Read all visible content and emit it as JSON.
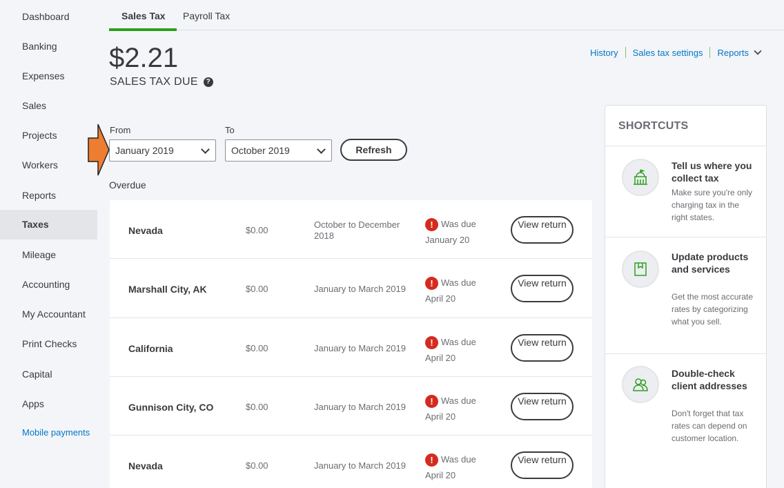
{
  "sidebar": {
    "items": [
      {
        "label": "Dashboard"
      },
      {
        "label": "Banking"
      },
      {
        "label": "Expenses"
      },
      {
        "label": "Sales"
      },
      {
        "label": "Projects"
      },
      {
        "label": "Workers"
      },
      {
        "label": "Reports"
      },
      {
        "label": "Taxes",
        "active": true
      },
      {
        "label": "Mileage"
      },
      {
        "label": "Accounting"
      },
      {
        "label": "My Accountant"
      },
      {
        "label": "Print Checks"
      },
      {
        "label": "Capital"
      },
      {
        "label": "Apps"
      }
    ],
    "mobile_payments": "Mobile payments"
  },
  "tabs": [
    {
      "label": "Sales Tax",
      "active": true
    },
    {
      "label": "Payroll Tax"
    }
  ],
  "header": {
    "amount": "$2.21",
    "amount_label": "SALES TAX DUE",
    "links": {
      "history": "History",
      "settings": "Sales tax settings",
      "reports": "Reports"
    }
  },
  "filters": {
    "from_label": "From",
    "from_value": "January 2019",
    "to_label": "To",
    "to_value": "October 2019",
    "refresh": "Refresh"
  },
  "section_label": "Overdue",
  "rows": [
    {
      "name": "Nevada",
      "amount": "$0.00",
      "period": "October to December 2018",
      "due_label": "Was due",
      "due_date": "January 20",
      "action": "View return"
    },
    {
      "name": "Marshall City, AK",
      "amount": "$0.00",
      "period": "January to March 2019",
      "due_label": "Was due",
      "due_date": "April 20",
      "action": "View return"
    },
    {
      "name": "California",
      "amount": "$0.00",
      "period": "January to March 2019",
      "due_label": "Was due",
      "due_date": "April 20",
      "action": "View return"
    },
    {
      "name": "Gunnison City, CO",
      "amount": "$0.00",
      "period": "January to March 2019",
      "due_label": "Was due",
      "due_date": "April 20",
      "action": "View return"
    },
    {
      "name": "Nevada",
      "amount": "$0.00",
      "period": "January to March 2019",
      "due_label": "Was due",
      "due_date": "April 20",
      "action": "View return"
    }
  ],
  "shortcuts": {
    "title": "SHORTCUTS",
    "items": [
      {
        "icon": "building-icon",
        "heading": "Tell us where you collect tax",
        "desc": "Make sure you're only charging tax in the right states."
      },
      {
        "icon": "box-icon",
        "heading": "Update products and services",
        "desc": "Get the most accurate rates by categorizing what you sell."
      },
      {
        "icon": "people-icon",
        "heading": "Double-check client addresses",
        "desc": "Don't forget that tax rates can depend on customer location."
      }
    ]
  },
  "colors": {
    "accent_green": "#2ca01c",
    "link_blue": "#0077c5",
    "warning_red": "#d52b1e",
    "callout_orange": "#ed7d31"
  }
}
